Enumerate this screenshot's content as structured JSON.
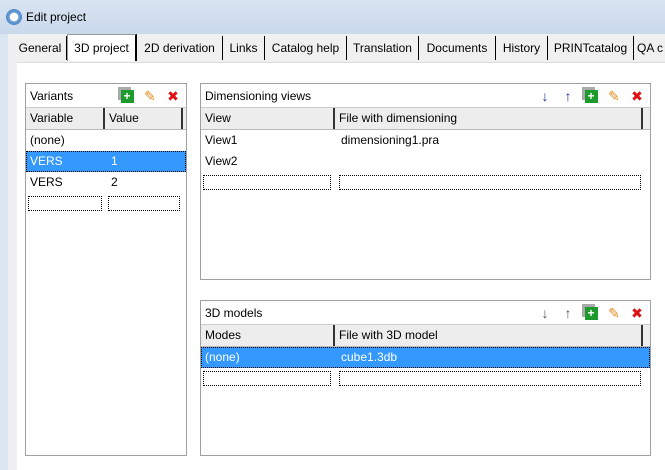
{
  "window": {
    "title": "Edit project"
  },
  "tabs": [
    {
      "label": "General"
    },
    {
      "label": "3D project"
    },
    {
      "label": "2D derivation"
    },
    {
      "label": "Links"
    },
    {
      "label": "Catalog help"
    },
    {
      "label": "Translation"
    },
    {
      "label": "Documents"
    },
    {
      "label": "History"
    },
    {
      "label": "PRINTcatalog"
    },
    {
      "label": "QA c"
    }
  ],
  "variants": {
    "title": "Variants",
    "columns": [
      "Variable",
      "Value"
    ],
    "rows": [
      [
        "(none)",
        ""
      ],
      [
        "VERS",
        "1"
      ],
      [
        "VERS",
        "2"
      ]
    ]
  },
  "dimensioning": {
    "title": "Dimensioning views",
    "columns": [
      "View",
      "File with dimensioning"
    ],
    "rows": [
      [
        "View1",
        "dimensioning1.pra"
      ],
      [
        "View2",
        ""
      ]
    ]
  },
  "models": {
    "title": "3D models",
    "columns": [
      "Modes",
      "File with 3D model"
    ],
    "rows": [
      [
        "(none)",
        "cube1.3db"
      ]
    ]
  },
  "icons": {
    "down": "↓",
    "up": "↑",
    "add": "+",
    "edit": "✎",
    "delete": "✖"
  }
}
